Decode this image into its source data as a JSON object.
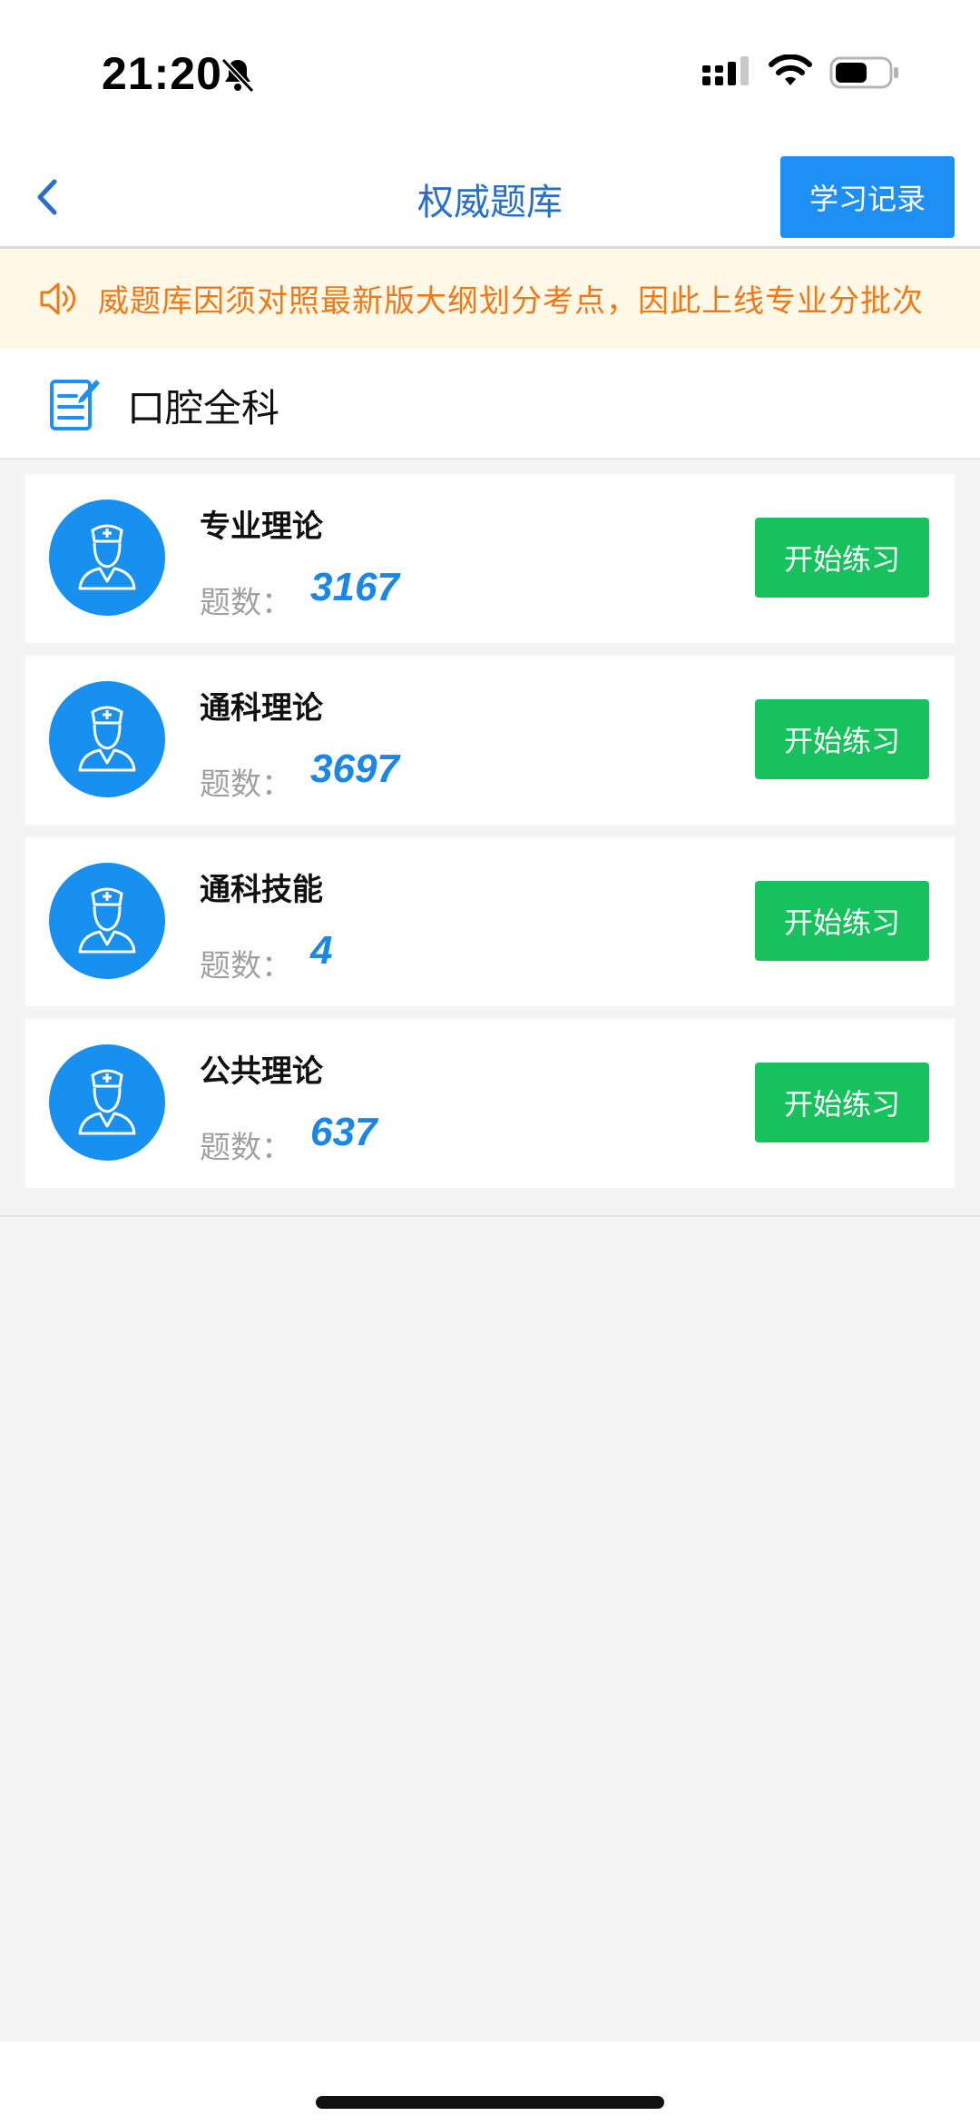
{
  "status_bar": {
    "time": "21:20",
    "icons": [
      "bell-off-icon",
      "signal-icon",
      "wifi-icon",
      "battery-icon"
    ]
  },
  "nav": {
    "title": "权威题库",
    "back_icon": "chevron-left-icon",
    "record_button": "学习记录"
  },
  "notice": {
    "icon": "speaker-icon",
    "text": "威题库因须对照最新版大纲划分考点，因此上线专业分批次"
  },
  "category": {
    "icon": "edit-note-icon",
    "title": "口腔全科"
  },
  "subjects": [
    {
      "title": "专业理论",
      "count_label": "题数：",
      "count": "3167",
      "button": "开始练习"
    },
    {
      "title": "通科理论",
      "count_label": "题数：",
      "count": "3697",
      "button": "开始练习"
    },
    {
      "title": "通科技能",
      "count_label": "题数：",
      "count": "4",
      "button": "开始练习"
    },
    {
      "title": "公共理论",
      "count_label": "题数：",
      "count": "637",
      "button": "开始练习"
    }
  ],
  "colors": {
    "primary_blue": "#1e8ff5",
    "title_blue": "#2a6fc3",
    "count_blue": "#1a86e6",
    "start_green": "#17c25e",
    "notice_orange": "#ed7a1a",
    "notice_bg": "#fff8e6"
  }
}
